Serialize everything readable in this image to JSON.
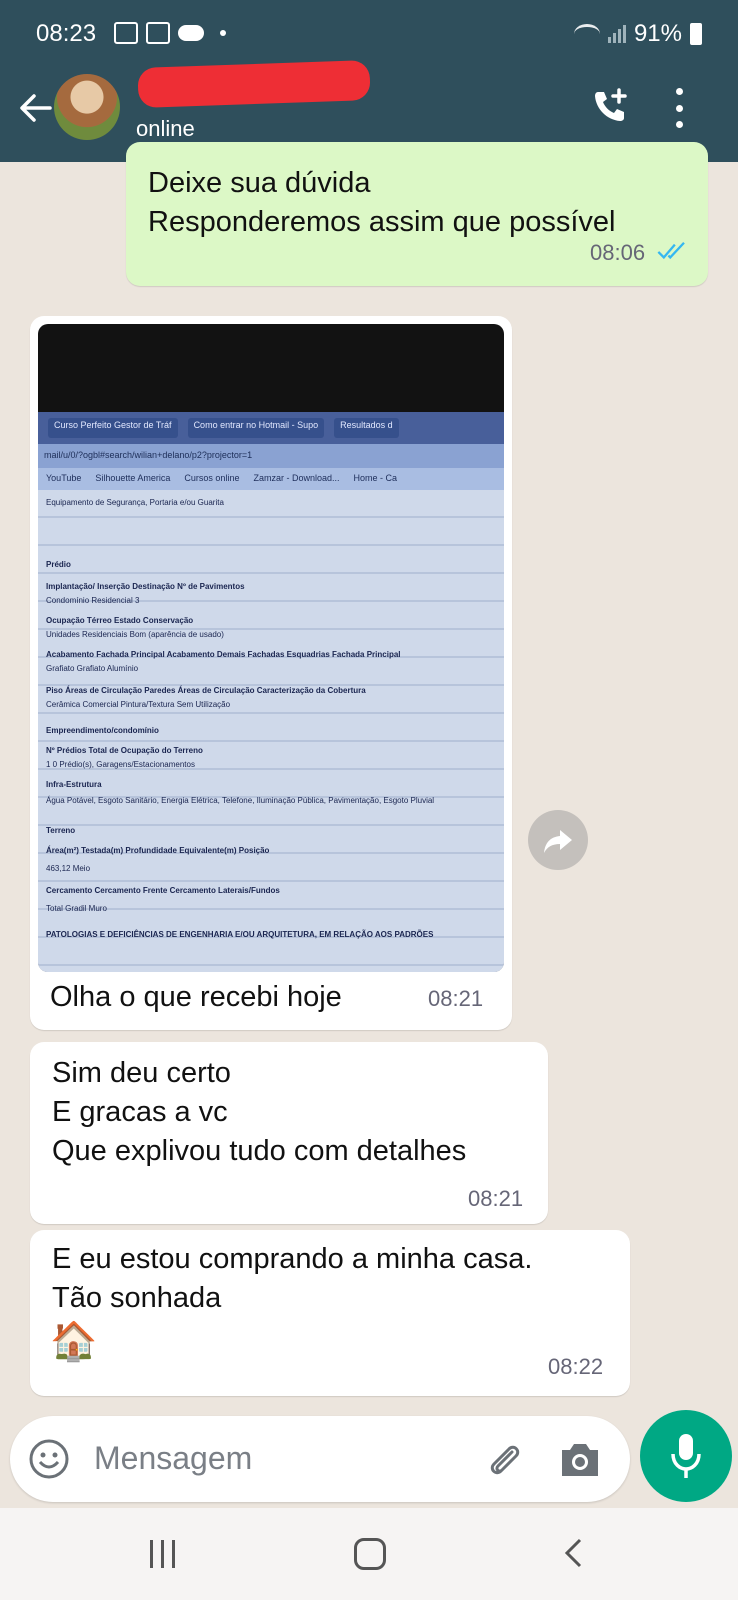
{
  "status_bar": {
    "time": "08:23",
    "battery": "91%"
  },
  "header": {
    "contact_status": "online",
    "icons": [
      "back-arrow-icon",
      "add-call-icon",
      "more-vert-icon"
    ]
  },
  "messages": [
    {
      "side": "out",
      "text": "Deixe sua dúvida\nResponderemos assim que possível",
      "time": "08:06",
      "ticks": "double-check-read"
    },
    {
      "side": "in",
      "type": "image",
      "caption": "Olha o que recebi hoje",
      "time": "08:21"
    },
    {
      "side": "in",
      "text": "Sim deu certo\nE gracas a vc\nQue explivou tudo com detalhes",
      "time": "08:21"
    },
    {
      "side": "in",
      "text": "E eu estou comprando a minha casa.\nTão sonhada",
      "emoji": "🏠",
      "time": "08:22"
    }
  ],
  "photo_doc": {
    "tabs": [
      "Curso Perfeito Gestor de Tráf",
      "Como entrar no Hotmail - Supo",
      "Resultados d"
    ],
    "url": "mail/u/0/?ogbl#search/wilian+delano/p2?projector=1",
    "bookmarks": [
      "YouTube",
      "Silhouette America",
      "Cursos online",
      "Zamzar - Download...",
      "Home - Ca"
    ],
    "rows": [
      "Equipamento de Segurança, Portaria e/ou Guarita",
      "Prédio",
      "Implantação/ Inserção   Destinação   Nº de Pavimentos",
      "Condomínio   Residencial   3",
      "Ocupação Térreo   Estado Conservação",
      "Unidades Residenciais   Bom (aparência de usado)",
      "Acabamento Fachada Principal   Acabamento Demais Fachadas   Esquadrias Fachada Principal",
      "Grafiato   Grafiato   Alumínio",
      "Piso Áreas de Circulação   Paredes Áreas de Circulação   Caracterização da Cobertura",
      "Cerâmica Comercial   Pintura/Textura   Sem Utilização",
      "Empreendimento/condomínio",
      "Nº Prédios   Total de   Ocupação do Terreno",
      "1   0   Prédio(s), Garagens/Estacionamentos",
      "Infra-Estrutura",
      "Água Potável, Esgoto Sanitário, Energia Elétrica, Telefone, Iluminação Pública, Pavimentação, Esgoto Pluvial",
      "Terreno",
      "Área(m²)   Testada(m)   Profundidade Equivalente(m)   Posição",
      "463,12   Meio",
      "Cercamento   Cercamento Frente   Cercamento Laterais/Fundos",
      "Total   Gradil   Muro",
      "PATOLOGIAS E DEFICIÊNCIAS DE ENGENHARIA E/OU ARQUITETURA, EM RELAÇÃO AOS PADRÕES"
    ]
  },
  "input": {
    "placeholder": "Mensagem"
  },
  "colors": {
    "header": "#2f4f5c",
    "outgoing": "#dcf8c6",
    "incoming": "#ffffff",
    "mic": "#00a884",
    "read_ticks": "#34b7f1"
  }
}
